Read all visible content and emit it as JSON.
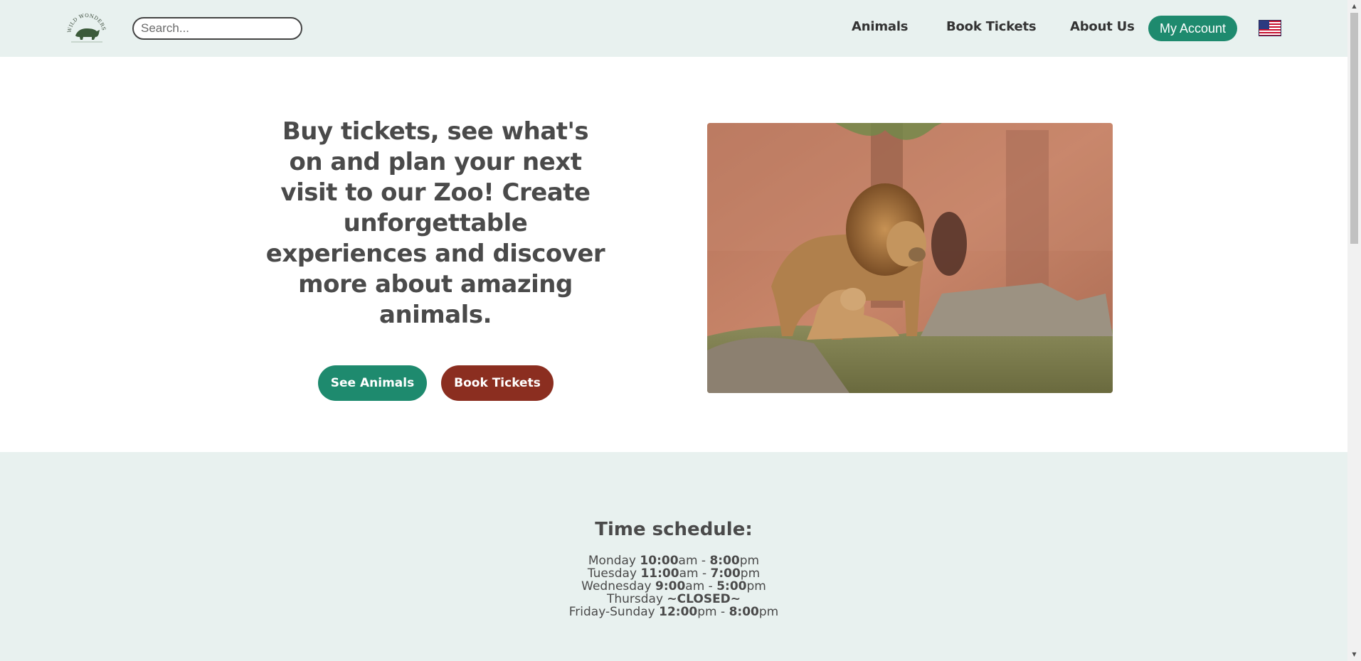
{
  "header": {
    "logo_text": "WILD WONDERS ZOO",
    "search_placeholder": "Search...",
    "nav": {
      "animals": "Animals",
      "book_tickets": "Book Tickets",
      "about_us": "About Us",
      "my_account": "My Account"
    },
    "language_icon": "us-flag-icon"
  },
  "hero": {
    "title": "Buy tickets, see what's on and plan your next visit to our Zoo! Create unforgettable experiences and discover more about amazing animals.",
    "see_animals": "See Animals",
    "book_tickets": "Book Tickets",
    "image_subject": "lions"
  },
  "schedule": {
    "title": "Time schedule:",
    "rows": [
      {
        "day": "Monday",
        "open": "10:00",
        "open_suffix": "am - ",
        "close": "8:00",
        "close_suffix": "pm"
      },
      {
        "day": "Tuesday",
        "open": "11:00",
        "open_suffix": "am - ",
        "close": "7:00",
        "close_suffix": "pm"
      },
      {
        "day": "Wednesday",
        "open": "9:00",
        "open_suffix": "am - ",
        "close": "5:00",
        "close_suffix": "pm"
      },
      {
        "day": "Thursday",
        "status": "~CLOSED~"
      },
      {
        "day": "Friday-Sunday",
        "open": "12:00",
        "open_suffix": "pm - ",
        "close": "8:00",
        "close_suffix": "pm"
      }
    ]
  },
  "colors": {
    "accent_green": "#1e8a6e",
    "accent_red": "#8b2e20",
    "header_bg": "#e8f1ef",
    "text": "#4a4a4a"
  }
}
